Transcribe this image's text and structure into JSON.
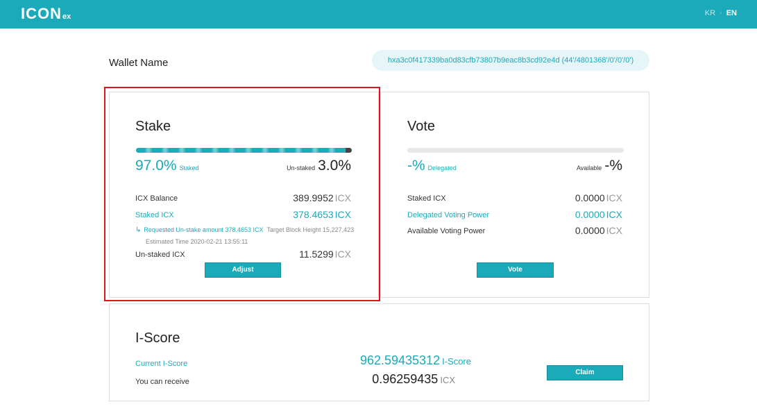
{
  "header": {
    "logo_main": "ICON",
    "logo_suffix": "ex",
    "lang_kr": "KR",
    "lang_sep": "·",
    "lang_en": "EN"
  },
  "wallet": {
    "name": "Wallet Name",
    "address": "hxa3c0f417339ba0d83cfb73807b9eac8b3cd92e4d (44'/4801368'/0'/0'/0')"
  },
  "stake": {
    "title": "Stake",
    "staked_percent": "97.0%",
    "staked_fraction": 0.97,
    "staked_label": "Staked",
    "unstaked_label": "Un-staked",
    "unstaked_percent": "3.0%",
    "icx_balance_label": "ICX Balance",
    "icx_balance_value": "389.9952",
    "staked_icx_label": "Staked ICX",
    "staked_icx_value": "378.4653",
    "request_text": "Requested Un-stake amount 378.4653 ICX",
    "target_block_text": "Target Block Height 15,227,423",
    "estimated_time_text": "Estimated Time 2020-02-21 13:55:11",
    "unstaked_icx_label": "Un-staked ICX",
    "unstaked_icx_value": "11.5299",
    "unit": "ICX",
    "adjust_button": "Adjust"
  },
  "vote": {
    "title": "Vote",
    "delegated_percent": "-%",
    "delegated_label": "Delegated",
    "available_label": "Available",
    "available_percent": "-%",
    "staked_icx_label": "Staked ICX",
    "staked_icx_value": "0.0000",
    "delegated_power_label": "Delegated Voting Power",
    "delegated_power_value": "0.0000",
    "available_power_label": "Available Voting Power",
    "available_power_value": "0.0000",
    "unit": "ICX",
    "vote_button": "Vote"
  },
  "iscore": {
    "title": "I-Score",
    "current_label": "Current I-Score",
    "current_value": "962.59435312",
    "current_unit": "I-Score",
    "receive_label": "You can receive",
    "receive_value": "0.96259435",
    "receive_unit": "ICX",
    "claim_button": "Claim"
  },
  "colors": {
    "accent": "#1aaaba",
    "highlight": "#e0141e"
  }
}
